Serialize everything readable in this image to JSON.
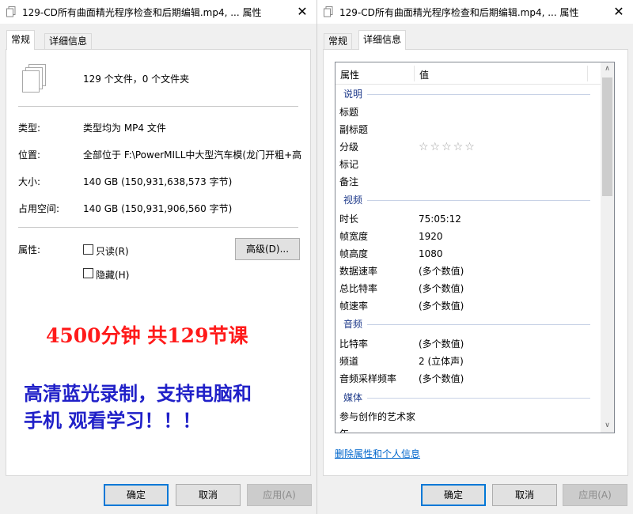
{
  "left": {
    "title": "129-CD所有曲面精光程序检查和后期编辑.mp4, ... 属性",
    "close_glyph": "✕",
    "tabs": [
      "常规",
      "详细信息"
    ],
    "summary": "129 个文件，0 个文件夹",
    "fields": {
      "type_label": "类型:",
      "type_value": "类型均为 MP4 文件",
      "location_label": "位置:",
      "location_value": "全部位于 F:\\PowerMILL中大型汽车模(龙门开粗+高速",
      "size_label": "大小:",
      "size_value": "140 GB (150,931,638,573 字节)",
      "disk_label": "占用空间:",
      "disk_value": "140 GB (150,931,906,560 字节)"
    },
    "attributes": {
      "label": "属性:",
      "readonly": "只读(R)",
      "hidden": "隐藏(H)",
      "advanced": "高级(D)..."
    },
    "promo": {
      "line1": "4500分钟  共129节课",
      "line2": "高清蓝光录制，支持电脑和",
      "line3": "手机 观看学习！！！"
    },
    "buttons": {
      "ok": "确定",
      "cancel": "取消",
      "apply": "应用(A)"
    }
  },
  "right": {
    "title": "129-CD所有曲面精光程序检查和后期编辑.mp4, ... 属性",
    "close_glyph": "✕",
    "tabs": [
      "常规",
      "详细信息"
    ],
    "header": {
      "property": "属性",
      "value": "值"
    },
    "groups": {
      "description": "说明",
      "video": "视频",
      "audio": "音频",
      "media": "媒体"
    },
    "rows": {
      "title": "标题",
      "subtitle": "副标题",
      "rating": "分级",
      "rating_stars": "☆☆☆☆☆",
      "tags": "标记",
      "comments": "备注",
      "duration": "时长",
      "duration_value": "75:05:12",
      "frame_width": "帧宽度",
      "frame_width_value": "1920",
      "frame_height": "帧高度",
      "frame_height_value": "1080",
      "data_rate": "数据速率",
      "data_rate_value": "(多个数值)",
      "total_bitrate": "总比特率",
      "total_bitrate_value": "(多个数值)",
      "frame_rate": "帧速率",
      "frame_rate_value": "(多个数值)",
      "bitrate": "比特率",
      "bitrate_value": "(多个数值)",
      "channels": "频道",
      "channels_value": "2 (立体声)",
      "sample_rate": "音频采样频率",
      "sample_rate_value": "(多个数值)",
      "contributing_artists": "参与创作的艺术家",
      "year": "年"
    },
    "scroll": {
      "up": "∧",
      "down": "∨"
    },
    "remove_link": "删除属性和个人信息",
    "buttons": {
      "ok": "确定",
      "cancel": "取消",
      "apply": "应用(A)"
    }
  }
}
